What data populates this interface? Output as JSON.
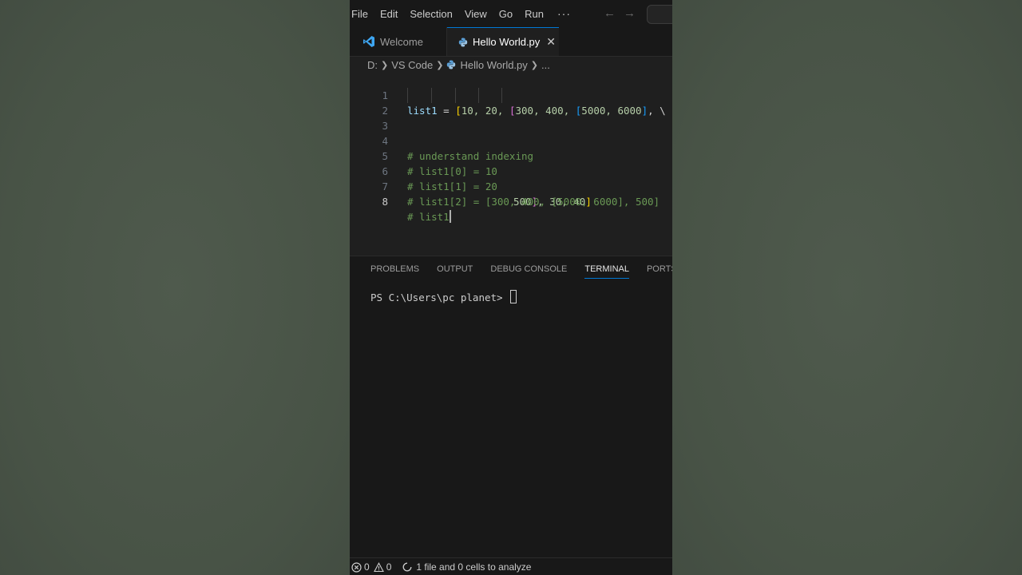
{
  "menubar": {
    "items": [
      "File",
      "Edit",
      "Selection",
      "View",
      "Go",
      "Run"
    ],
    "more": "···",
    "back": "←",
    "forward": "→"
  },
  "tabs": [
    {
      "label": "Welcome",
      "icon": "vscode-logo-icon",
      "active": false
    },
    {
      "label": "Hello World.py",
      "icon": "python-icon",
      "active": true,
      "close": "✕"
    }
  ],
  "breadcrumb": {
    "drive": "D:",
    "folder": "VS Code",
    "file": "Hello World.py",
    "rest": "..."
  },
  "editor": {
    "lines": [
      {
        "n": "1",
        "parts": [
          "list1",
          " = ",
          "[",
          "10, 20, ",
          "[",
          "300, 400, ",
          "[",
          "5000, 6000",
          "]",
          ", \\"
        ]
      },
      {
        "n": "2",
        "parts": [
          "500",
          "]",
          ", 30, 40",
          "]"
        ]
      },
      {
        "n": "3",
        "parts": []
      },
      {
        "n": "4",
        "text": "# understand indexing"
      },
      {
        "n": "5",
        "text": "# list1[0] = 10"
      },
      {
        "n": "6",
        "text": "# list1[1] = 20"
      },
      {
        "n": "7",
        "text": "# list1[2] = [300, 400, [5000, 6000], 500]"
      },
      {
        "n": "8",
        "text": "# list1",
        "active": true
      }
    ]
  },
  "panel": {
    "tabs": [
      "PROBLEMS",
      "OUTPUT",
      "DEBUG CONSOLE",
      "TERMINAL",
      "PORTS"
    ],
    "active_tab": "TERMINAL",
    "prompt": "PS C:\\Users\\pc planet> "
  },
  "status": {
    "errors": "0",
    "warnings": "0",
    "analysis": "1 file and 0 cells to analyze"
  },
  "colors": {
    "accent": "#0078d4",
    "editor_bg": "#1f1f1f",
    "comment": "#6a9955",
    "bracket1": "#ffd700",
    "bracket2": "#da70d6",
    "bracket3": "#179fff"
  }
}
